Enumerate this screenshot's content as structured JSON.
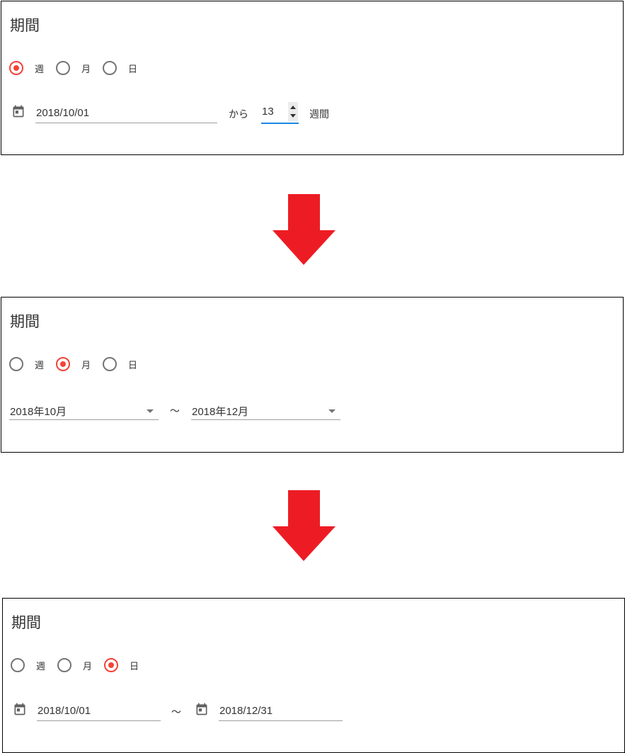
{
  "colors": {
    "radio_checked": "#f44336",
    "radio_unchecked": "#757575",
    "focus_underline": "#1e88e5",
    "arrow": "#ed1c24"
  },
  "panels": [
    {
      "title": "期間",
      "radios": [
        {
          "label": "週",
          "checked": true
        },
        {
          "label": "月",
          "checked": false
        },
        {
          "label": "日",
          "checked": false
        }
      ],
      "start_date": "2018/10/01",
      "from_label": "から",
      "count_value": "13",
      "unit_label": "週間"
    },
    {
      "title": "期間",
      "radios": [
        {
          "label": "週",
          "checked": false
        },
        {
          "label": "月",
          "checked": true
        },
        {
          "label": "日",
          "checked": false
        }
      ],
      "start_month": "2018年10月",
      "tilde": "～",
      "end_month": "2018年12月"
    },
    {
      "title": "期間",
      "radios": [
        {
          "label": "週",
          "checked": false
        },
        {
          "label": "月",
          "checked": false
        },
        {
          "label": "日",
          "checked": true
        }
      ],
      "start_date": "2018/10/01",
      "tilde": "～",
      "end_date": "2018/12/31"
    }
  ],
  "icons": {
    "calendar": "calendar-icon",
    "dropdown": "chevron-down-icon",
    "spinner": "spinner-icon",
    "transition_arrow": "arrow-down-icon"
  }
}
